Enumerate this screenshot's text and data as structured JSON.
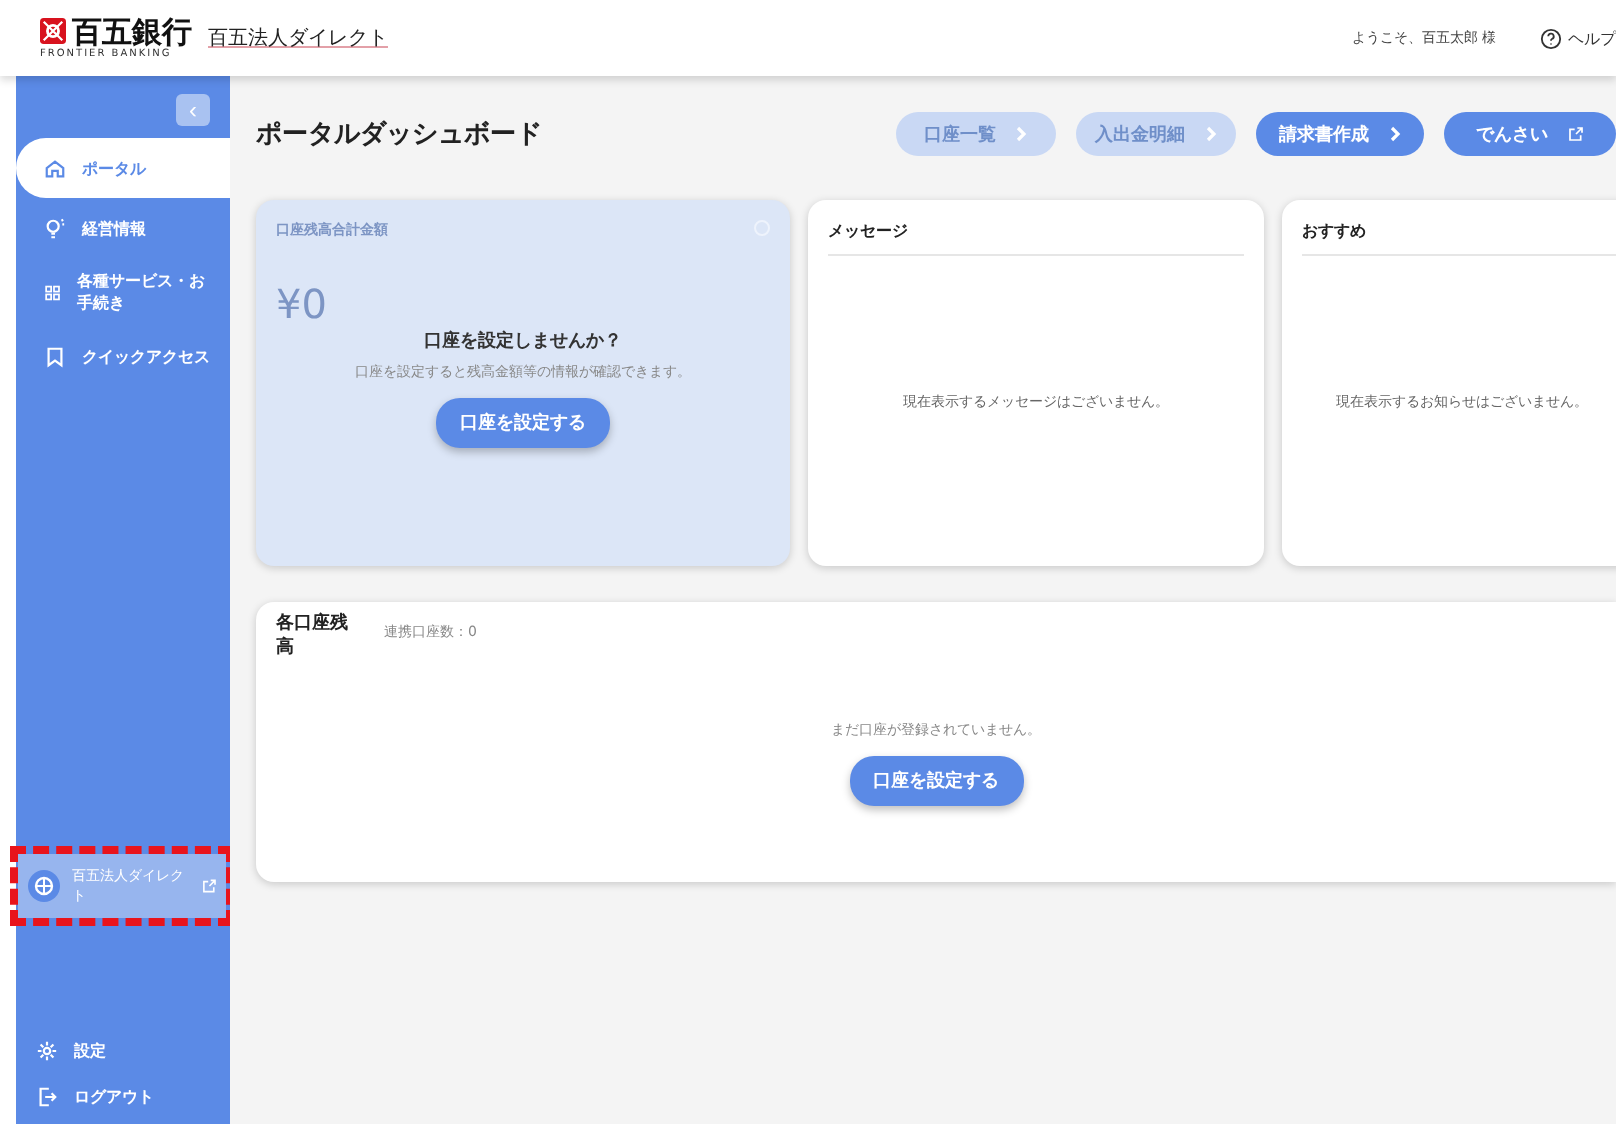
{
  "header": {
    "brand_name": "百五銀行",
    "brand_sub": "FRONTIER BANKING",
    "service_name": "百五法人ダイレクト",
    "welcome": "ようこそ、百五太郎 様",
    "help": "ヘルプ"
  },
  "sidebar": {
    "collapse_button": "‹",
    "items": [
      {
        "kind": "home",
        "label": "ポータル",
        "selected": true
      },
      {
        "kind": "bulb",
        "label": "経営情報",
        "selected": false
      },
      {
        "kind": "grid",
        "label": "各種サービス・お手続き",
        "selected": false
      },
      {
        "kind": "bookmark",
        "label": "クイックアクセス",
        "selected": false
      }
    ],
    "external_link": {
      "label": "百五法人ダイレクト",
      "highlighted": true
    },
    "bottom_items": [
      {
        "kind": "gear",
        "label": "設定"
      },
      {
        "kind": "logout",
        "label": "ログアウト"
      }
    ]
  },
  "page_title": "ポータルダッシュボード",
  "actions": [
    {
      "label": "口座一覧",
      "disabled": true,
      "kind": "chevron"
    },
    {
      "label": "入出金明細",
      "disabled": true,
      "kind": "chevron"
    },
    {
      "label": "請求書作成",
      "disabled": false,
      "kind": "chevron"
    },
    {
      "label": "でんさい",
      "disabled": false,
      "kind": "external"
    }
  ],
  "balance_card": {
    "title": "口座残高合計金額",
    "amount": "¥0",
    "prompt_title": "口座を設定しませんか？",
    "prompt_text": "口座を設定すると残高金額等の情報が確認できます。",
    "button": "口座を設定する"
  },
  "message_card": {
    "title": "メッセージ",
    "empty_text": "現在表示するメッセージはございません。"
  },
  "recommend_card": {
    "title": "おすすめ",
    "empty_text": "現在表示するお知らせはございません。"
  },
  "accounts_card": {
    "title": "各口座残高",
    "linked_count": "連携口座数：0",
    "empty_text": "まだ口座が登録されていません。",
    "button": "口座を設定する"
  }
}
